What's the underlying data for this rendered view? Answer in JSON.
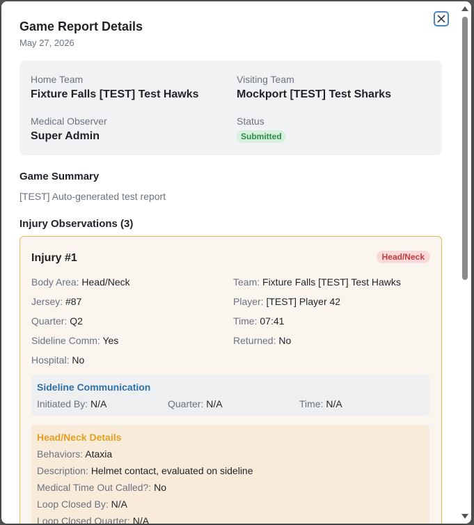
{
  "modal": {
    "title": "Game Report Details",
    "date": "May 27, 2026"
  },
  "info": {
    "home_team_label": "Home Team",
    "home_team_value": "Fixture Falls [TEST] Test Hawks",
    "visiting_team_label": "Visiting Team",
    "visiting_team_value": "Mockport [TEST] Test Sharks",
    "observer_label": "Medical Observer",
    "observer_value": "Super Admin",
    "status_label": "Status",
    "status_value": "Submitted"
  },
  "summary": {
    "title": "Game Summary",
    "text": "[TEST] Auto-generated test report"
  },
  "injuries": {
    "title": "Injury Observations (3)",
    "items": [
      {
        "title": "Injury #1",
        "badge": "Head/Neck",
        "fields": {
          "body_area_label": "Body Area:",
          "body_area_value": "Head/Neck",
          "team_label": "Team:",
          "team_value": "Fixture Falls [TEST] Test Hawks",
          "jersey_label": "Jersey:",
          "jersey_value": "#87",
          "player_label": "Player:",
          "player_value": "[TEST] Player 42",
          "quarter_label": "Quarter:",
          "quarter_value": "Q2",
          "time_label": "Time:",
          "time_value": "07:41",
          "sideline_comm_label": "Sideline Comm:",
          "sideline_comm_value": "Yes",
          "returned_label": "Returned:",
          "returned_value": "No",
          "hospital_label": "Hospital:",
          "hospital_value": "No"
        },
        "sideline": {
          "title": "Sideline Communication",
          "initiated_label": "Initiated By:",
          "initiated_value": "N/A",
          "quarter_label": "Quarter:",
          "quarter_value": "N/A",
          "time_label": "Time:",
          "time_value": "N/A"
        },
        "headneck": {
          "title": "Head/Neck Details",
          "behaviors_label": "Behaviors:",
          "behaviors_value": "Ataxia",
          "description_label": "Description:",
          "description_value": "Helmet contact, evaluated on sideline",
          "timeout_label": "Medical Time Out Called?:",
          "timeout_value": "No",
          "loop_closed_label": "Loop Closed By:",
          "loop_closed_value": "N/A",
          "loop_quarter_label": "Loop Closed Quarter:",
          "loop_quarter_value": "N/A"
        }
      }
    ]
  },
  "icons": {
    "close": "close-icon"
  },
  "colors": {
    "accent": "#4a86c5",
    "status_green": "#2e8b4a",
    "badge_red": "#c33b3b",
    "injury_border": "#e8b860",
    "headneck_title": "#e0a020",
    "sideline_title": "#2f6fa8"
  }
}
